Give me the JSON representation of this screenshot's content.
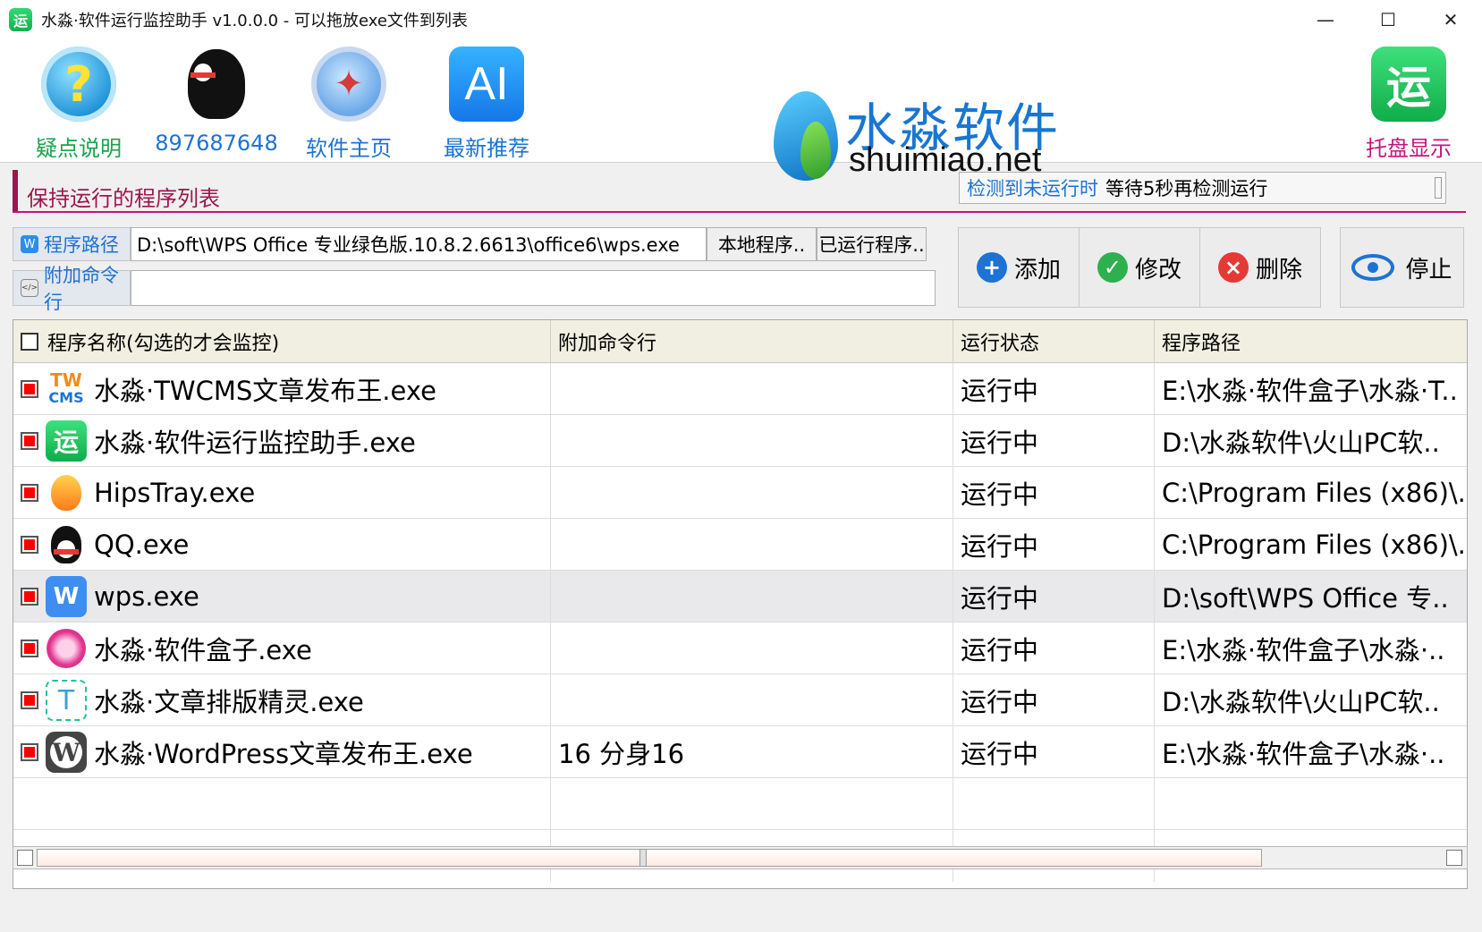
{
  "window": {
    "title": "水淼·软件运行监控助手 v1.0.0.0 - 可以拖放exe文件到列表",
    "app_icon": "运",
    "minimize": "—",
    "maximize": "☐",
    "close": "✕"
  },
  "toolbar": {
    "help_label": "疑点说明",
    "qq_label": "897687648",
    "home_label": "软件主页",
    "recommend_label": "最新推荐",
    "tray_label": "托盘显示",
    "ai_text": "AI",
    "tray_icon": "运"
  },
  "brand": {
    "cn": "水淼软件",
    "en": "shuimiao.net"
  },
  "section": {
    "title": "保持运行的程序列表",
    "wait_label": "检测到未运行时",
    "wait_value": "等待5秒再检测运行"
  },
  "path": {
    "label": "程序路径",
    "value": "D:\\soft\\WPS Office 专业绿色版.10.8.2.6613\\office6\\wps.exe",
    "local_btn": "本地程序..",
    "running_btn": "已运行程序.."
  },
  "cmd": {
    "label": "附加命令行",
    "value": ""
  },
  "actions": {
    "add": "添加",
    "edit": "修改",
    "delete": "删除",
    "stop": "停止"
  },
  "table": {
    "columns": [
      "程序名称(勾选的才会监控)",
      "附加命令行",
      "运行状态",
      "程序路径"
    ],
    "rows": [
      {
        "icon": "twcms-icon",
        "name": "水淼·TWCMS文章发布王.exe",
        "cmd": "",
        "status": "运行中",
        "path": "E:\\水淼·软件盒子\\水淼·T.."
      },
      {
        "icon": "monitor-app-icon",
        "name": "水淼·软件运行监控助手.exe",
        "cmd": "",
        "status": "运行中",
        "path": "D:\\水淼软件\\火山PC软.."
      },
      {
        "icon": "hipstray-icon",
        "name": "HipsTray.exe",
        "cmd": "",
        "status": "运行中",
        "path": "C:\\Program Files (x86)\\.."
      },
      {
        "icon": "qq-icon",
        "name": "QQ.exe",
        "cmd": "",
        "status": "运行中",
        "path": "C:\\Program Files (x86)\\.."
      },
      {
        "icon": "wps-icon",
        "name": "wps.exe",
        "cmd": "",
        "status": "运行中",
        "path": "D:\\soft\\WPS Office 专.."
      },
      {
        "icon": "software-box-icon",
        "name": "水淼·软件盒子.exe",
        "cmd": "",
        "status": "运行中",
        "path": "E:\\水淼·软件盒子\\水淼·.."
      },
      {
        "icon": "text-layout-icon",
        "name": "水淼·文章排版精灵.exe",
        "cmd": "",
        "status": "运行中",
        "path": "D:\\水淼软件\\火山PC软.."
      },
      {
        "icon": "wordpress-icon",
        "name": "水淼·WordPress文章发布王.exe",
        "cmd": "16 分身16",
        "status": "运行中",
        "path": "E:\\水淼·软件盒子\\水淼·.."
      }
    ]
  },
  "icon_glyphs": {
    "twcms_top": "TW",
    "twcms_bottom": "CMS",
    "yun": "运",
    "wps": "W",
    "text": "T",
    "wordpress": "W",
    "help": "?"
  }
}
